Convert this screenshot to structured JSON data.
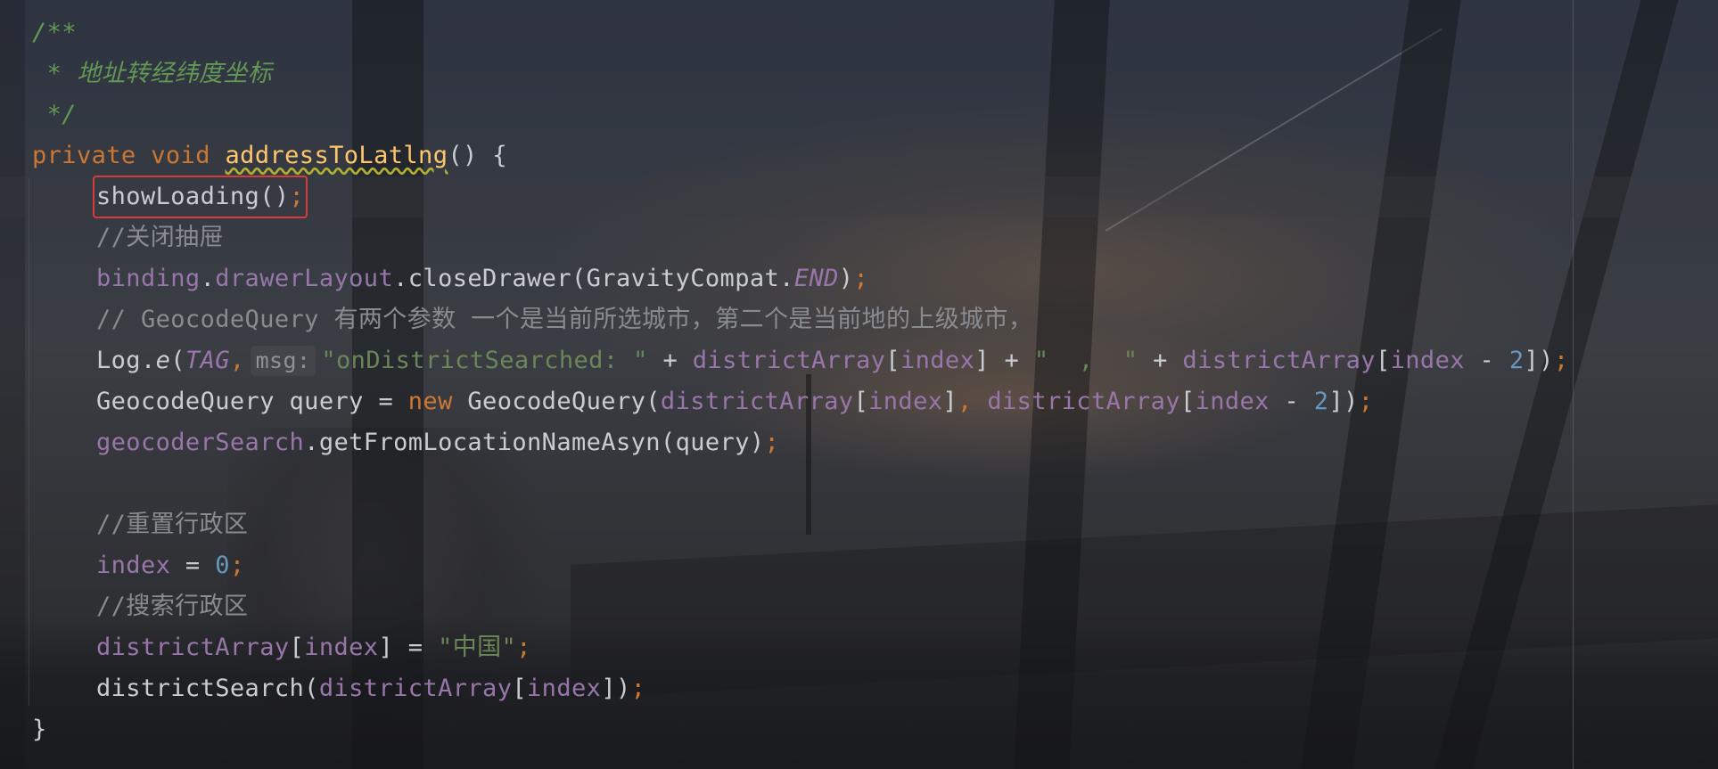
{
  "code_lines": [
    {
      "doc_open": "/**"
    },
    {
      "doc_text": " * 地址转经纬度坐标"
    },
    {
      "doc_close": " */"
    },
    {
      "kw1": "private",
      "kw2": "void",
      "method_name": "addressToLatlng",
      "rest": "() {"
    },
    {
      "call": "showLoading()",
      "semi": ";"
    },
    {
      "comment": "//关闭抽屉"
    },
    {
      "field1": "binding",
      "dot1": ".",
      "field2": "drawerLayout",
      "call": ".closeDrawer(GravityCompat.",
      "const": "END",
      "close": ")",
      "semi": ";"
    },
    {
      "comment": "// GeocodeQuery 有两个参数 一个是当前所选城市，第二个是当前地的上级城市，"
    },
    {
      "log": "Log.",
      "log_method": "e",
      "open": "(",
      "tag": "TAG",
      "comma": ",",
      "hint": "msg:",
      "str1": "\"onDistrictSearched: \"",
      "plus1": " + ",
      "arr1": "districtArray",
      "idx1_open": "[",
      "idx1_var": "index",
      "idx1_close": "]",
      "plus2": " + ",
      "str2": "\"  ,  \"",
      "plus3": " + ",
      "arr2": "districtArray",
      "idx2_open": "[",
      "idx2_var": "index",
      "idx2_op": " - ",
      "idx2_num": "2",
      "idx2_close": "])",
      "semi": ";"
    },
    {
      "type": "GeocodeQuery query = ",
      "kw": "new",
      "ctor": " GeocodeQuery(",
      "arr1": "districtArray",
      "b1": "[",
      "v1": "index",
      "b1c": "]",
      "comma": ", ",
      "arr2": "districtArray",
      "b2": "[",
      "v2": "index",
      "op": " - ",
      "num": "2",
      "b2c": "])",
      "semi": ";"
    },
    {
      "field": "geocoderSearch",
      "call": ".getFromLocationNameAsyn(query)",
      "semi": ";"
    },
    {
      "blank": ""
    },
    {
      "comment": "//重置行政区"
    },
    {
      "var": "index",
      "eq": " = ",
      "num": "0",
      "semi": ";"
    },
    {
      "comment": "//搜索行政区"
    },
    {
      "arr": "districtArray",
      "b": "[",
      "v": "index",
      "bc": "]",
      "eq": " = ",
      "str": "\"中国\"",
      "semi": ";"
    },
    {
      "call": "districtSearch(",
      "arr": "districtArray",
      "b": "[",
      "v": "index",
      "bc": "])",
      "semi": ";"
    },
    {
      "brace": "}"
    }
  ],
  "colors": {
    "keyword": "#cc7832",
    "method_decl": "#ffc66d",
    "field": "#9876aa",
    "doc_comment": "#629755",
    "line_comment": "#888b90",
    "string": "#6a8759",
    "number": "#6897bb",
    "highlight_box": "#d83b3b"
  }
}
